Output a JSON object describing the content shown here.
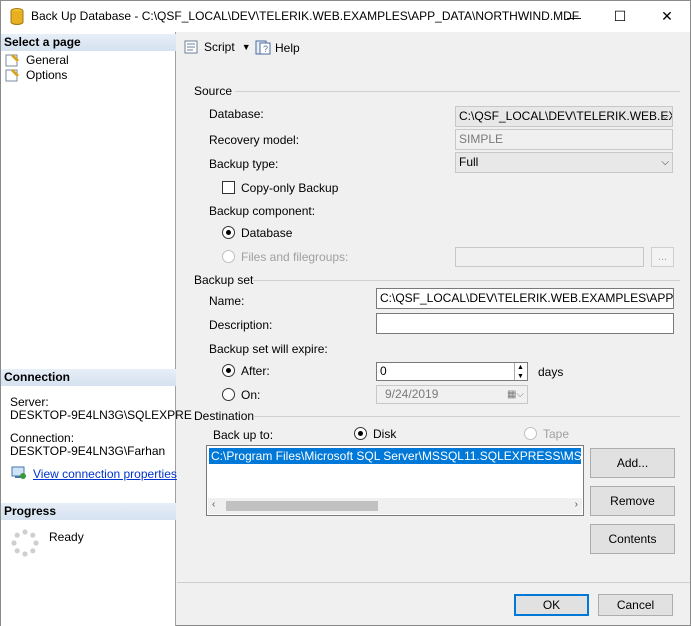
{
  "window": {
    "title": "Back Up Database - C:\\QSF_LOCAL\\DEV\\TELERIK.WEB.EXAMPLES\\APP_DATA\\NORTHWIND.MDF"
  },
  "left": {
    "select_page": "Select a page",
    "pages": [
      "General",
      "Options"
    ],
    "connection_header": "Connection",
    "server_label": "Server:",
    "server_value": "DESKTOP-9E4LN3G\\SQLEXPRE",
    "connection_label": "Connection:",
    "connection_value": "DESKTOP-9E4LN3G\\Farhan",
    "view_props": "View connection properties",
    "progress_header": "Progress",
    "progress_status": "Ready"
  },
  "toolbar": {
    "script": "Script",
    "help": "Help"
  },
  "source": {
    "group": "Source",
    "database_label": "Database:",
    "database_value": "C:\\QSF_LOCAL\\DEV\\TELERIK.WEB.EX",
    "recovery_label": "Recovery model:",
    "recovery_value": "SIMPLE",
    "backup_type_label": "Backup type:",
    "backup_type_value": "Full",
    "copy_only": "Copy-only Backup",
    "component_label": "Backup component:",
    "component_database": "Database",
    "component_files": "Files and filegroups:",
    "ellipsis": "..."
  },
  "backup_set": {
    "group": "Backup set",
    "name_label": "Name:",
    "name_value": "C:\\QSF_LOCAL\\DEV\\TELERIK.WEB.EXAMPLES\\APP_DAT",
    "description_label": "Description:",
    "description_value": "",
    "expire_label": "Backup set will expire:",
    "after_label": "After:",
    "after_value": "0",
    "days": "days",
    "on_label": "On:",
    "on_value": "9/24/2019"
  },
  "destination": {
    "group": "Destination",
    "backup_to_label": "Back up to:",
    "disk": "Disk",
    "tape": "Tape",
    "path": "C:\\Program Files\\Microsoft SQL Server\\MSSQL11.SQLEXPRESS\\MSSQL\\Ba",
    "add": "Add...",
    "remove": "Remove",
    "contents": "Contents"
  },
  "footer": {
    "ok": "OK",
    "cancel": "Cancel"
  },
  "colors": {
    "accent": "#0078d7",
    "link": "#0033cc"
  }
}
